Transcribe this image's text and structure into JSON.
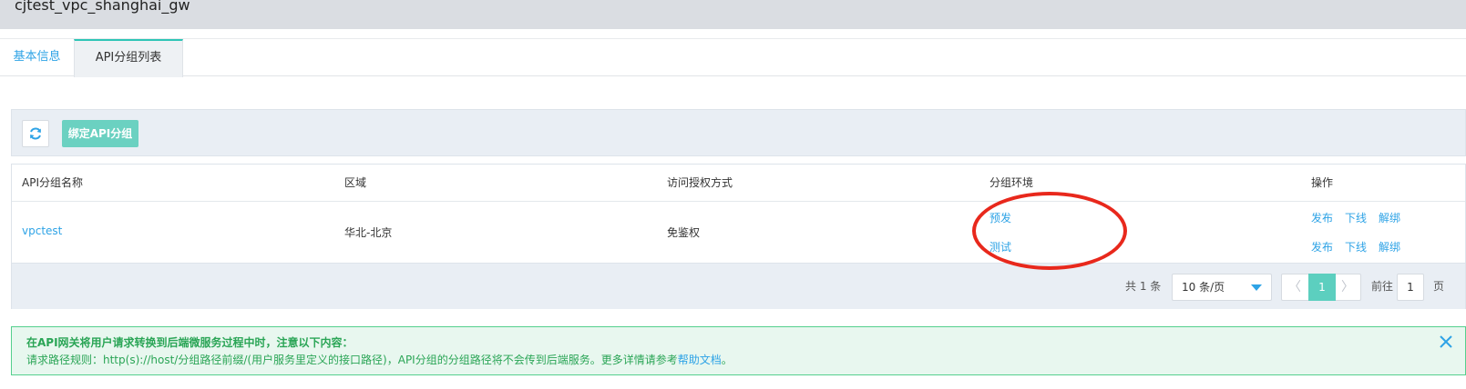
{
  "header": {
    "title": "cjtest_vpc_shanghai_gw"
  },
  "tabs": [
    {
      "label": "基本信息",
      "active": false
    },
    {
      "label": "API分组列表",
      "active": true
    }
  ],
  "toolbar": {
    "refresh_icon": "refresh-icon",
    "bind_label": "绑定API分组"
  },
  "table": {
    "columns": [
      "API分组名称",
      "区域",
      "访问授权方式",
      "分组环境",
      "操作"
    ],
    "rows": [
      {
        "name": "vpctest",
        "region": "华北-北京",
        "auth": "免鉴权",
        "environments": [
          {
            "env": "预发",
            "actions": [
              "发布",
              "下线",
              "解绑"
            ]
          },
          {
            "env": "测试",
            "actions": [
              "发布",
              "下线",
              "解绑"
            ]
          }
        ]
      }
    ]
  },
  "pagination": {
    "total": "共 1 条",
    "page_size": "10 条/页",
    "prev": "〈",
    "current": "1",
    "next": "〉",
    "goto_label": "前往",
    "goto_value": "1",
    "page_unit": "页"
  },
  "notice": {
    "title": "在API网关将用户请求转换到后端微服务过程中时，注意以下内容：",
    "body_prefix": "请求路径规则：http(s)://host/分组路径前缀/(用户服务里定义的接口路径)，API分组的分组路径将不会传到后端服务。更多详情请参考",
    "help_link": "帮助文档",
    "body_suffix": "。"
  },
  "colors": {
    "accent_link": "#2ea3e6",
    "teal_button": "#6bd1c1",
    "notice_green": "#2aa556",
    "annotation_red": "#e8281c"
  }
}
